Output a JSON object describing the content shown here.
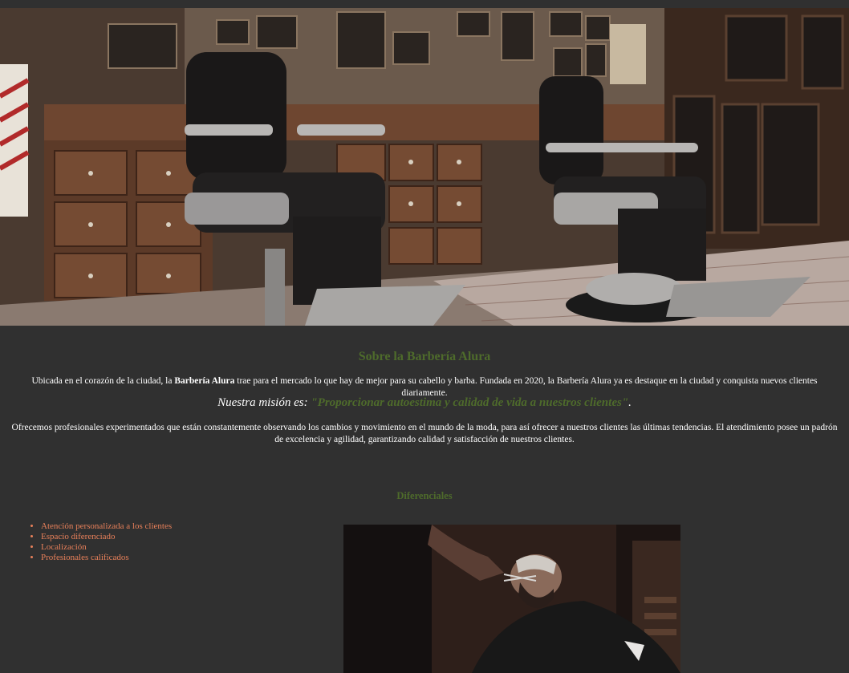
{
  "about": {
    "title": "Sobre la Barbería Alura",
    "intro_before": "Ubicada en el corazón de la ciudad, la ",
    "intro_brand": "Barbería Alura",
    "intro_after": " trae para el mercado lo que hay de mejor para su cabello y barba. Fundada en 2020, la Barbería Alura ya es destaque en la ciudad y conquista nuevos clientes diariamente.",
    "mission_label": "Nuestra misión es: ",
    "mission_quote": "\"Proporcionar autoestima y calidad de vida a nuestros clientes\"",
    "mission_end": ".",
    "offer": "Ofrecemos profesionales experimentados que están constantemente observando los cambios y movimiento en el mundo de la moda, para así ofrecer a nuestros clientes las últimas tendencias. El atendimiento posee un padrón de excelencia y agilidad, garantizando calidad y satisfacción de nuestros clientes."
  },
  "diferenciales": {
    "title": "Diferenciales",
    "items": [
      "Atención personalizada a los clientes",
      "Espacio diferenciado",
      "Localización",
      "Profesionales calificados"
    ]
  },
  "colors": {
    "background": "#303030",
    "heading_green": "#4e6b2b",
    "list_orange": "#e8805a",
    "text": "#ffffff"
  }
}
